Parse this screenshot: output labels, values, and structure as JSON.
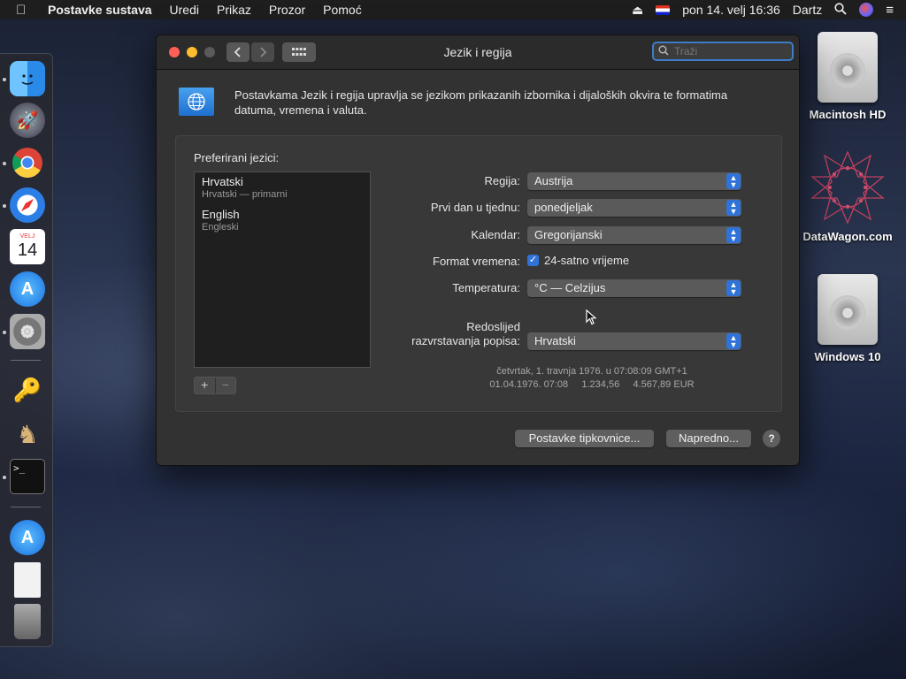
{
  "menubar": {
    "app": "Postavke sustava",
    "menus": [
      "Uredi",
      "Prikaz",
      "Prozor",
      "Pomoć"
    ],
    "datetime": "pon 14. velj 16:36",
    "user": "Dartz"
  },
  "desktop": [
    {
      "label": "Macintosh HD"
    },
    {
      "label": "DataWagon.com"
    },
    {
      "label": "Windows 10"
    }
  ],
  "dock": {
    "calendar_month": "VELJ",
    "calendar_day": "14"
  },
  "window": {
    "title": "Jezik i regija",
    "search_placeholder": "Traži",
    "intro": "Postavkama Jezik i regija upravlja se jezikom prikazanih izbornika i dijaloških okvira te formatima datuma, vremena i valuta.",
    "preferred_label": "Preferirani jezici:",
    "languages": [
      {
        "name": "Hrvatski",
        "sub": "Hrvatski — primarni"
      },
      {
        "name": "English",
        "sub": "Engleski"
      }
    ],
    "add": "+",
    "remove": "−",
    "settings": {
      "region_label": "Regija:",
      "region": "Austrija",
      "first_day_label": "Prvi dan u tjednu:",
      "first_day": "ponedjeljak",
      "calendar_label": "Kalendar:",
      "calendar": "Gregorijanski",
      "time_format_label": "Format vremena:",
      "time_format": "24-satno vrijeme",
      "temperature_label": "Temperatura:",
      "temperature": "°C — Celzijus",
      "sort_label_1": "Redoslijed",
      "sort_label_2": "razvrstavanja popisa:",
      "sort": "Hrvatski"
    },
    "sample_line1": "četvrtak, 1. travnja 1976. u 07:08:09 GMT+1",
    "sample_line2": "01.04.1976. 07:08     1.234,56     4.567,89 EUR",
    "keyboard_button": "Postavke tipkovnice...",
    "advanced_button": "Napredno...",
    "help": "?"
  }
}
